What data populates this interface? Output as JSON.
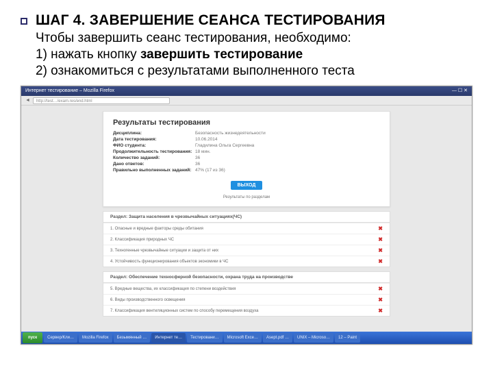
{
  "slide": {
    "title": "ШАГ 4. ЗАВЕРШЕНИЕ СЕАНСА ТЕСТИРОВАНИЯ",
    "line1": "Чтобы завершить сеанс тестирования, необходимо:",
    "line2_pre": "1) нажать кнопку   ",
    "line2_bold": "завершить тестирование",
    "line3": "2) ознакомиться с результатами выполненного теста"
  },
  "browser": {
    "window_title": "Интернет тестирование – Mozilla Firefox",
    "url": "http://test…/exam.res/end.html"
  },
  "results": {
    "heading": "Результаты тестирования",
    "rows": [
      {
        "k": "Дисциплина:",
        "v": "Безопасность жизнедеятельности"
      },
      {
        "k": "Дата тестирования:",
        "v": "10.06.2014"
      },
      {
        "k": "ФИО студента:",
        "v": "Гладилина Ольга Сергеевна"
      },
      {
        "k": "Продолжительность тестирования:",
        "v": "18 мин."
      },
      {
        "k": "Количество заданий:",
        "v": "36"
      },
      {
        "k": "Дано ответов:",
        "v": "36"
      },
      {
        "k": "Правильно выполненных заданий:",
        "v": "47% (17 из 36)"
      }
    ],
    "exit_button": "ВЫХОД",
    "caption": "Результаты по разделам"
  },
  "sections": [
    "Раздел: Защита населения в чрезвычайных ситуациях(ЧС)",
    "Раздел: Обеспечение техносферной безопасности, охрана труда на производстве"
  ],
  "questions_a": [
    "1. Опасные и вредные факторы среды обитания",
    "2. Классификация природных ЧС",
    "3. Техногенные чрезвычайные ситуации и защита от них",
    "4. Устойчивость функционирования объектов экономики в ЧС"
  ],
  "questions_b": [
    "5. Вредные вещества, их классификация по степени воздействия",
    "6. Виды производственного освещения",
    "7. Классификация вентиляционных систем по способу перемещения воздуха"
  ],
  "taskbar": {
    "start": "пуск",
    "items": [
      "Сервер/Кли…",
      "Mozilla Firefox",
      "Безымянный …",
      "Интернет те…",
      "Тестировани…",
      "Microsoft Exce…",
      "Asept.pdf …",
      "UNIX – Microso…",
      "12 – Paint"
    ]
  }
}
